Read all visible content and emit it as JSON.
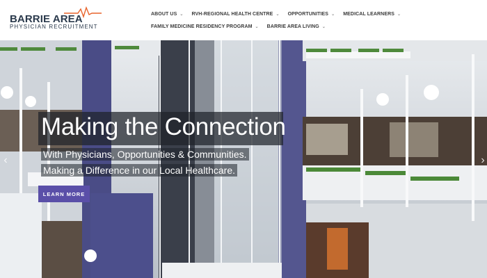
{
  "logo": {
    "title": "BARRIE AREA",
    "subtitle": "PHYSICIAN RECRUITMENT",
    "accent_color": "#e8632b"
  },
  "nav": {
    "row1": [
      {
        "label": "ABOUT US",
        "has_dropdown": true
      },
      {
        "label": "RVH-REGIONAL HEALTH CENTRE",
        "has_dropdown": true
      },
      {
        "label": "OPPORTUNITIES",
        "has_dropdown": true
      },
      {
        "label": "MEDICAL LEARNERS",
        "has_dropdown": true
      }
    ],
    "row2": [
      {
        "label": "FAMILY MEDICINE RESIDENCY PROGRAM",
        "has_dropdown": true
      },
      {
        "label": "BARRIE AREA LIVING",
        "has_dropdown": true
      }
    ],
    "caret": "⌄"
  },
  "hero": {
    "title": "Making the Connection",
    "line1": "With Physicians, Opportunities & Communities.",
    "line2": "Making a Difference in our Local Healthcare.",
    "button_label": "LEARN MORE",
    "button_color": "#5a4fa8",
    "prev_arrow": "‹",
    "next_arrow": "›"
  }
}
